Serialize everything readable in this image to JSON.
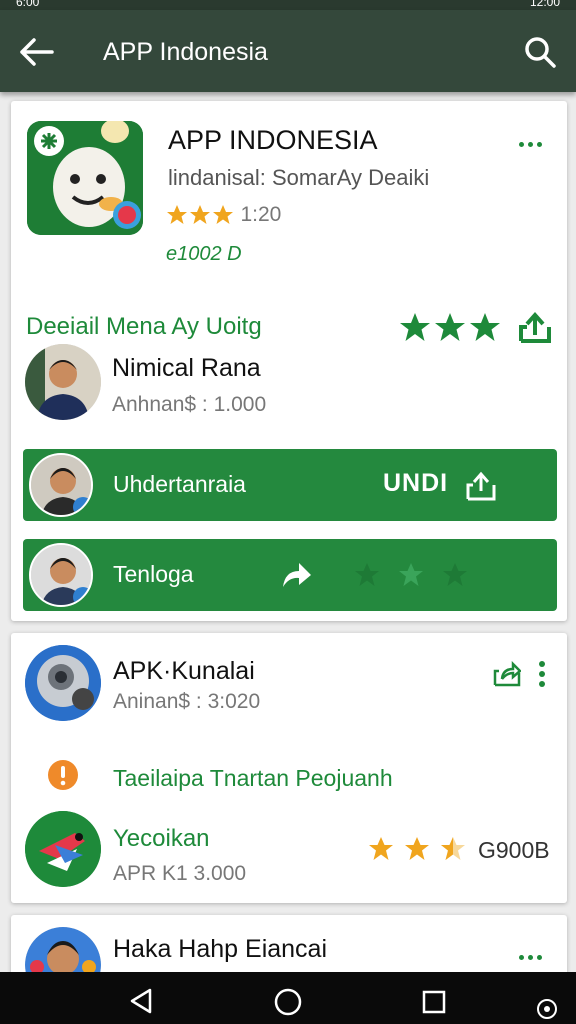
{
  "status_bar": {
    "time": "6:00",
    "right": "12:00"
  },
  "appbar": {
    "title": "APP Indonesia"
  },
  "card1": {
    "app_name": "APP INDONESIA",
    "subtitle": "lindanisal: SomarAy Deaiki",
    "rating_text": "1:20",
    "size_text": "e1002 D",
    "section_title": "Deeiail Mena Ay Uoitg",
    "profile": {
      "name": "Nimical Rana",
      "meta": "Anhnan$ : 1.000"
    },
    "row1": {
      "label": "Uhdertanraia",
      "action": "UNDI"
    },
    "row2": {
      "label": "Tenloga"
    }
  },
  "card2": {
    "app_name": "APK·Kunalai",
    "meta": "Aninan$ : 3:020",
    "info": "Taeilaipa Tnartan Peojuanh",
    "sub_app": {
      "name": "Yecoikan",
      "meta": "APR K1 3.000",
      "size": "G900B"
    }
  },
  "card3": {
    "title": "Haka Hahp Eiancai"
  },
  "colors": {
    "appbar": "#34483b",
    "accent": "#1e8a3a",
    "star": "#f0a51e"
  }
}
